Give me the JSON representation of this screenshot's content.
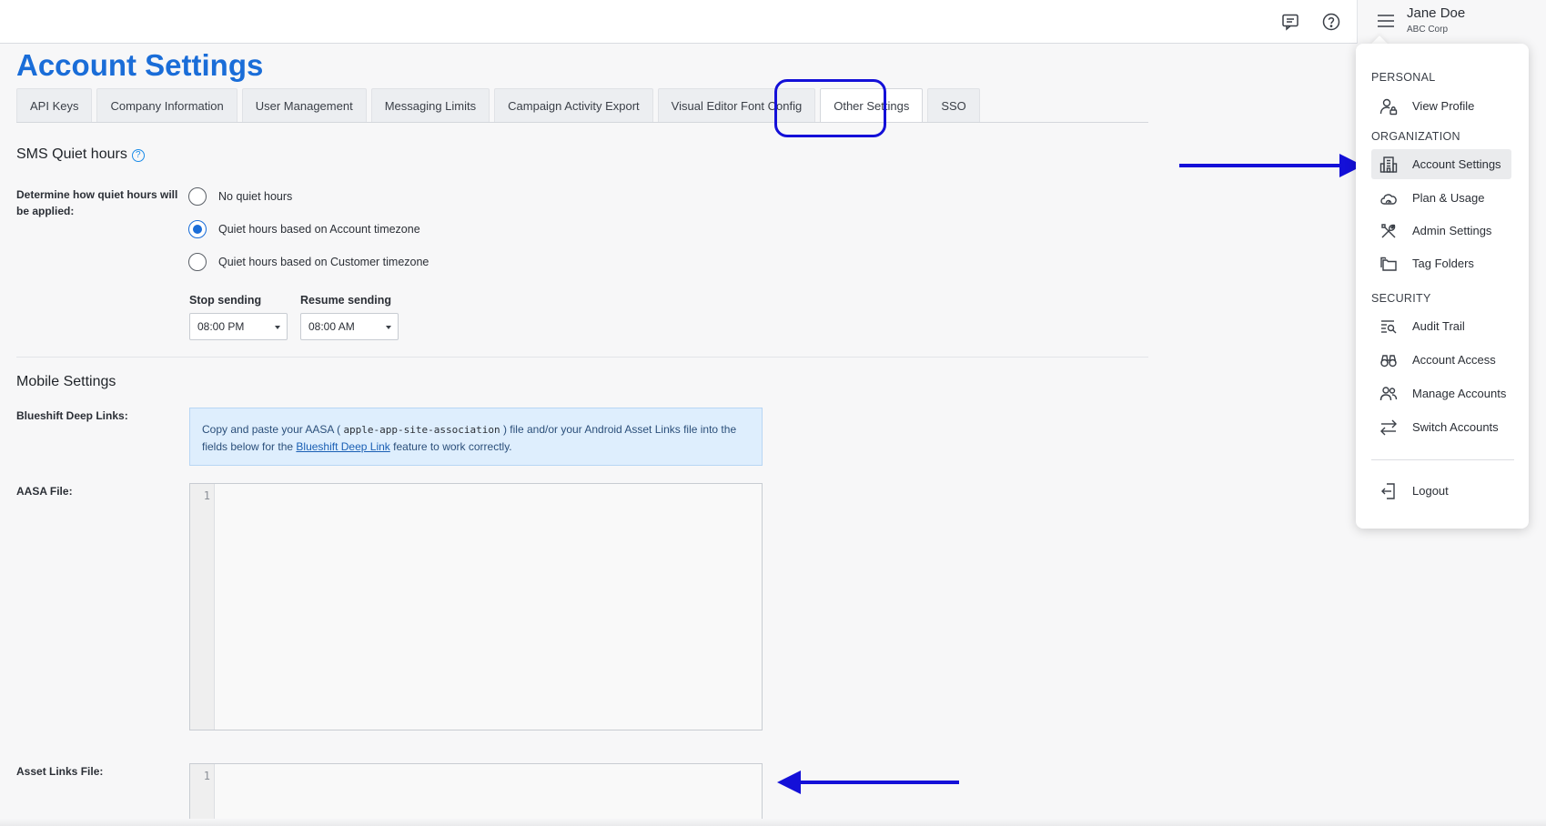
{
  "topbar": {
    "user_name": "Jane Doe",
    "user_org": "ABC Corp",
    "icons": [
      "chat-icon",
      "help-circle-icon",
      "hamburger-menu-icon"
    ]
  },
  "page": {
    "title": "Account Settings",
    "tabs": [
      {
        "label": "API Keys"
      },
      {
        "label": "Company Information"
      },
      {
        "label": "User Management"
      },
      {
        "label": "Messaging Limits"
      },
      {
        "label": "Campaign Activity Export"
      },
      {
        "label": "Visual Editor Font Config"
      },
      {
        "label": "Other Settings",
        "active": true
      },
      {
        "label": "SSO"
      }
    ]
  },
  "sms": {
    "title": "SMS Quiet hours",
    "help_glyph": "?",
    "determine_label": "Determine how quiet hours will be applied:",
    "options": [
      {
        "label": "No quiet hours",
        "checked": false
      },
      {
        "label": "Quiet hours based on Account timezone",
        "checked": true
      },
      {
        "label": "Quiet hours based on Customer timezone",
        "checked": false
      }
    ],
    "stop_label": "Stop sending",
    "stop_value": "08:00 PM",
    "resume_label": "Resume sending",
    "resume_value": "08:00 AM"
  },
  "mobile": {
    "title": "Mobile Settings",
    "deep_links_label": "Blueshift Deep Links:",
    "info_prefix": "Copy and paste your AASA (",
    "info_code": "apple-app-site-association",
    "info_middle": ") file and/or your Android Asset Links file into the fields below for the",
    "info_link": "Blueshift Deep Link",
    "info_suffix": "feature to work correctly.",
    "aasa_label": "AASA File:",
    "aasa_line": "1",
    "asset_links_label": "Asset Links File:",
    "asset_links_line": "1"
  },
  "menu": {
    "sections": [
      {
        "title": "PERSONAL",
        "items": [
          {
            "label": "View Profile",
            "icon": "user-lock-icon"
          }
        ]
      },
      {
        "title": "ORGANIZATION",
        "items": [
          {
            "label": "Account Settings",
            "icon": "building-icon",
            "selected": true
          },
          {
            "label": "Plan & Usage",
            "icon": "cloud-speedometer-icon"
          },
          {
            "label": "Admin Settings",
            "icon": "tools-icon"
          },
          {
            "label": "Tag Folders",
            "icon": "folders-icon"
          }
        ]
      },
      {
        "title": "SECURITY",
        "items": [
          {
            "label": "Audit Trail",
            "icon": "list-search-icon"
          },
          {
            "label": "Account Access",
            "icon": "binoculars-icon"
          },
          {
            "label": "Manage Accounts",
            "icon": "users-icon"
          },
          {
            "label": "Switch Accounts",
            "icon": "switch-arrows-icon"
          }
        ]
      }
    ],
    "logout_label": "Logout"
  },
  "colors": {
    "accent": "#1a6dd8",
    "annotation": "#1410d8",
    "info_bg": "#deeefd"
  }
}
